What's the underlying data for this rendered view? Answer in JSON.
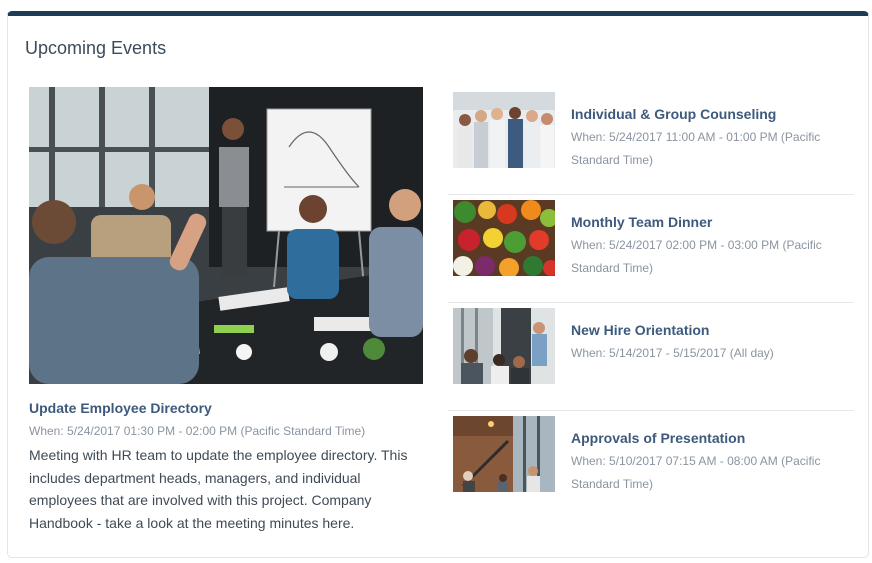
{
  "widget": {
    "title": "Upcoming Events"
  },
  "featured": {
    "title": "Update Employee Directory",
    "when": "When: 5/24/2017 01:30 PM - 02:00 PM (Pacific Standard Time)",
    "description": "Meeting with HR team to update the employee directory. This includes department heads, managers, and individual employees that are involved with this project. Company Handbook - take a look at the meeting minutes here."
  },
  "events": [
    {
      "title": "Individual & Group Counseling",
      "when": "When: 5/24/2017 11:00 AM - 01:00 PM (Pacific Standard Time)",
      "image": "team-photo"
    },
    {
      "title": "Monthly Team Dinner",
      "when": "When: 5/24/2017 02:00 PM - 03:00 PM (Pacific Standard Time)",
      "image": "vegetables-photo"
    },
    {
      "title": "New Hire Orientation",
      "when": "When: 5/14/2017 - 5/15/2017 (All day)",
      "image": "meeting-photo"
    },
    {
      "title": "Approvals of Presentation",
      "when": "When: 5/10/2017 07:15 AM - 08:00 AM (Pacific Standard Time)",
      "image": "office-photo"
    }
  ]
}
